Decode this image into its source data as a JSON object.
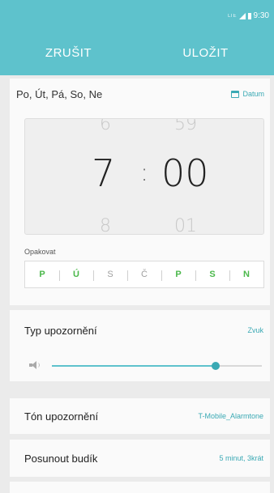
{
  "status_bar": {
    "network": "LTE",
    "time": "9:30"
  },
  "action_bar": {
    "cancel_label": "ZRUŠIT",
    "save_label": "ULOŽIT"
  },
  "alarm": {
    "days_summary": "Po, Út, Pá, So, Ne",
    "date_button": "Datum",
    "picker": {
      "hour_prev": "6",
      "hour": "7",
      "hour_next": "8",
      "separator": ":",
      "minute_prev": "59",
      "minute": "00",
      "minute_next": "01"
    },
    "repeat_label": "Opakovat",
    "days": [
      {
        "label": "P",
        "selected": true
      },
      {
        "label": "Ú",
        "selected": true
      },
      {
        "label": "S",
        "selected": false
      },
      {
        "label": "Č",
        "selected": false
      },
      {
        "label": "P",
        "selected": true
      },
      {
        "label": "S",
        "selected": true
      },
      {
        "label": "N",
        "selected": true
      }
    ]
  },
  "settings": {
    "alert_type": {
      "label": "Typ upozornění",
      "value": "Zvuk"
    },
    "volume": {
      "level": 0.78
    },
    "alert_tone": {
      "label": "Tón upozornění",
      "value": "T-Mobile_Alarmtone"
    },
    "snooze": {
      "label": "Posunout budík",
      "value": "5 minut, 3krát"
    }
  },
  "colors": {
    "accent": "#5ec2cc",
    "accent_dark": "#3aa9b4",
    "day_on": "#4bb84b",
    "day_off": "#a0a0a0"
  },
  "icons": [
    "calendar-icon",
    "speaker-icon"
  ]
}
